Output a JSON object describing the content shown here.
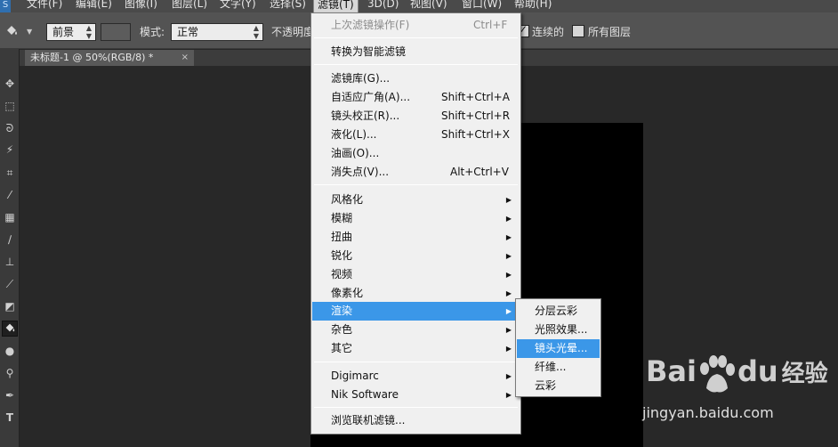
{
  "menubar": {
    "items": [
      {
        "label": "文件(F)"
      },
      {
        "label": "编辑(E)"
      },
      {
        "label": "图像(I)"
      },
      {
        "label": "图层(L)"
      },
      {
        "label": "文字(Y)"
      },
      {
        "label": "选择(S)"
      },
      {
        "label": "滤镜(T)",
        "active": true
      },
      {
        "label": "3D(D)"
      },
      {
        "label": "视图(V)"
      },
      {
        "label": "窗口(W)"
      },
      {
        "label": "帮助(H)"
      }
    ]
  },
  "options": {
    "fill_source": "前景",
    "mode_label": "模式:",
    "mode_value": "正常",
    "opacity_label": "不透明度",
    "contiguous_label": "连续的",
    "contiguous_checked": true,
    "all_layers_label": "所有图层",
    "all_layers_checked": false
  },
  "document_tab": {
    "title": "未标题-1 @ 50%(RGB/8) *",
    "close": "×"
  },
  "filter_menu": {
    "last_filter": {
      "label": "上次滤镜操作(F)",
      "shortcut": "Ctrl+F"
    },
    "convert_smart": "转换为智能滤镜",
    "group2": [
      {
        "label": "滤镜库(G)...",
        "shortcut": ""
      },
      {
        "label": "自适应广角(A)...",
        "shortcut": "Shift+Ctrl+A"
      },
      {
        "label": "镜头校正(R)...",
        "shortcut": "Shift+Ctrl+R"
      },
      {
        "label": "液化(L)...",
        "shortcut": "Shift+Ctrl+X"
      },
      {
        "label": "油画(O)...",
        "shortcut": ""
      },
      {
        "label": "消失点(V)...",
        "shortcut": "Alt+Ctrl+V"
      }
    ],
    "group3": [
      "风格化",
      "模糊",
      "扭曲",
      "锐化",
      "视频",
      "像素化",
      "渲染",
      "杂色",
      "其它"
    ],
    "group4": [
      "Digimarc",
      "Nik Software"
    ],
    "browse_online": "浏览联机滤镜..."
  },
  "render_submenu": {
    "items": [
      "分层云彩",
      "光照效果...",
      "镜头光晕...",
      "纤维...",
      "云彩"
    ],
    "highlighted_index": 2
  },
  "watermark": {
    "logo_bai": "Bai",
    "logo_du": "du",
    "logo_jingyan": "经验",
    "url": "jingyan.baidu.com"
  },
  "colors": {
    "highlight": "#3b97e8",
    "menu_bg": "#f0f0f0",
    "canvas": "#000000"
  }
}
